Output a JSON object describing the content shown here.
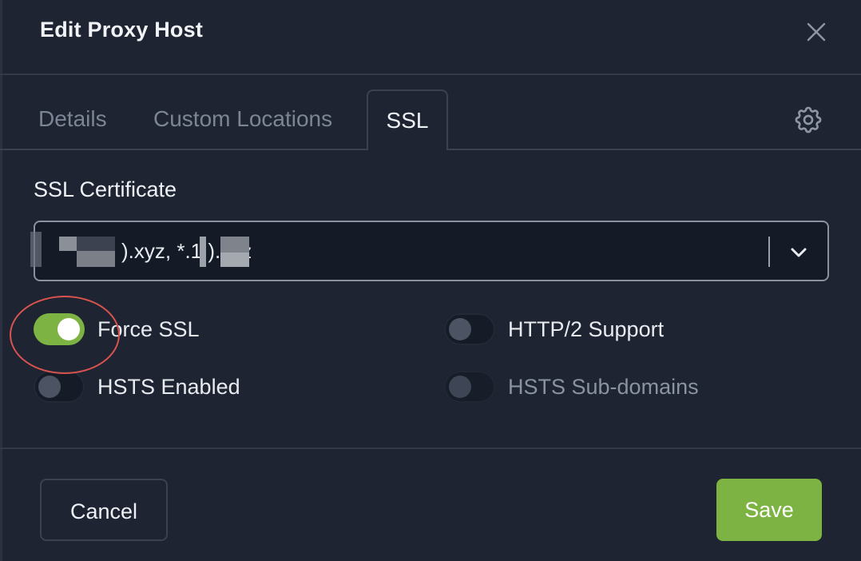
{
  "dialog": {
    "title": "Edit Proxy Host"
  },
  "tabs": [
    {
      "label": "Details",
      "active": false
    },
    {
      "label": "Custom Locations",
      "active": false
    },
    {
      "label": "SSL",
      "active": true
    }
  ],
  "ssl": {
    "certificate_label": "SSL Certificate",
    "certificate_value": ").xyz, *.1  ).xyz",
    "toggles": {
      "force_ssl": {
        "label": "Force SSL",
        "enabled": true
      },
      "http2_support": {
        "label": "HTTP/2 Support",
        "enabled": false
      },
      "hsts_enabled": {
        "label": "HSTS Enabled",
        "enabled": false
      },
      "hsts_subdomains": {
        "label": "HSTS Sub-domains",
        "enabled": false
      }
    }
  },
  "footer": {
    "cancel_label": "Cancel",
    "save_label": "Save"
  },
  "colors": {
    "accent_green": "#7cb342",
    "background": "#1e2431",
    "annotation_red": "#d9534f"
  },
  "icons": {
    "close": "close-icon",
    "settings": "gear-icon",
    "dropdown": "chevron-down-icon"
  }
}
